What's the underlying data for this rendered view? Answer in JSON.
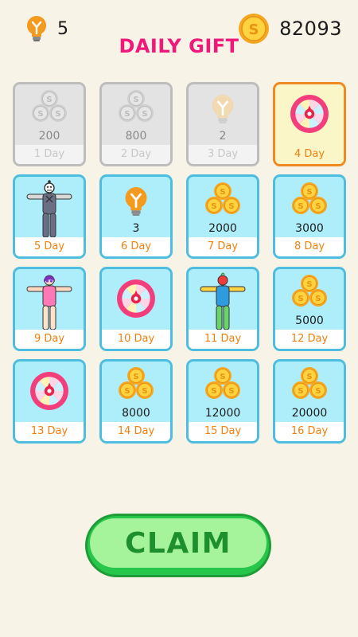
{
  "hud": {
    "bulbs": "5",
    "coins": "82093",
    "bulb_icon": "lightbulb-icon",
    "coin_icon": "coin-icon"
  },
  "title": "DAILY GIFT",
  "days": [
    {
      "label": "1 Day",
      "amount": "200",
      "reward": "coins",
      "state": "claimed"
    },
    {
      "label": "2 Day",
      "amount": "800",
      "reward": "coins",
      "state": "claimed"
    },
    {
      "label": "3 Day",
      "amount": "2",
      "reward": "lightbulb",
      "state": "claimed"
    },
    {
      "label": "4 Day",
      "amount": "",
      "reward": "lucky-wheel",
      "state": "today"
    },
    {
      "label": "5 Day",
      "amount": "",
      "reward": "skin-robot",
      "state": "locked"
    },
    {
      "label": "6 Day",
      "amount": "3",
      "reward": "lightbulb",
      "state": "locked"
    },
    {
      "label": "7 Day",
      "amount": "2000",
      "reward": "coins",
      "state": "locked"
    },
    {
      "label": "8 Day",
      "amount": "3000",
      "reward": "coins",
      "state": "locked"
    },
    {
      "label": "9 Day",
      "amount": "",
      "reward": "skin-girl",
      "state": "locked"
    },
    {
      "label": "10 Day",
      "amount": "",
      "reward": "lucky-wheel",
      "state": "locked"
    },
    {
      "label": "11 Day",
      "amount": "",
      "reward": "skin-rainbow",
      "state": "locked"
    },
    {
      "label": "12 Day",
      "amount": "5000",
      "reward": "coins",
      "state": "locked"
    },
    {
      "label": "13 Day",
      "amount": "",
      "reward": "lucky-wheel",
      "state": "locked"
    },
    {
      "label": "14 Day",
      "amount": "8000",
      "reward": "coins",
      "state": "locked"
    },
    {
      "label": "15 Day",
      "amount": "12000",
      "reward": "coins",
      "state": "locked"
    },
    {
      "label": "16 Day",
      "amount": "20000",
      "reward": "coins",
      "state": "locked"
    }
  ],
  "claim_button": "CLAIM",
  "colors": {
    "title": "#f0187a",
    "cell_border": "#4fbde0",
    "cell_bg": "#aeeefb",
    "today_border": "#f08a22",
    "label": "#f0800f",
    "button": "#26c64a",
    "background": "#f7f3e6"
  }
}
